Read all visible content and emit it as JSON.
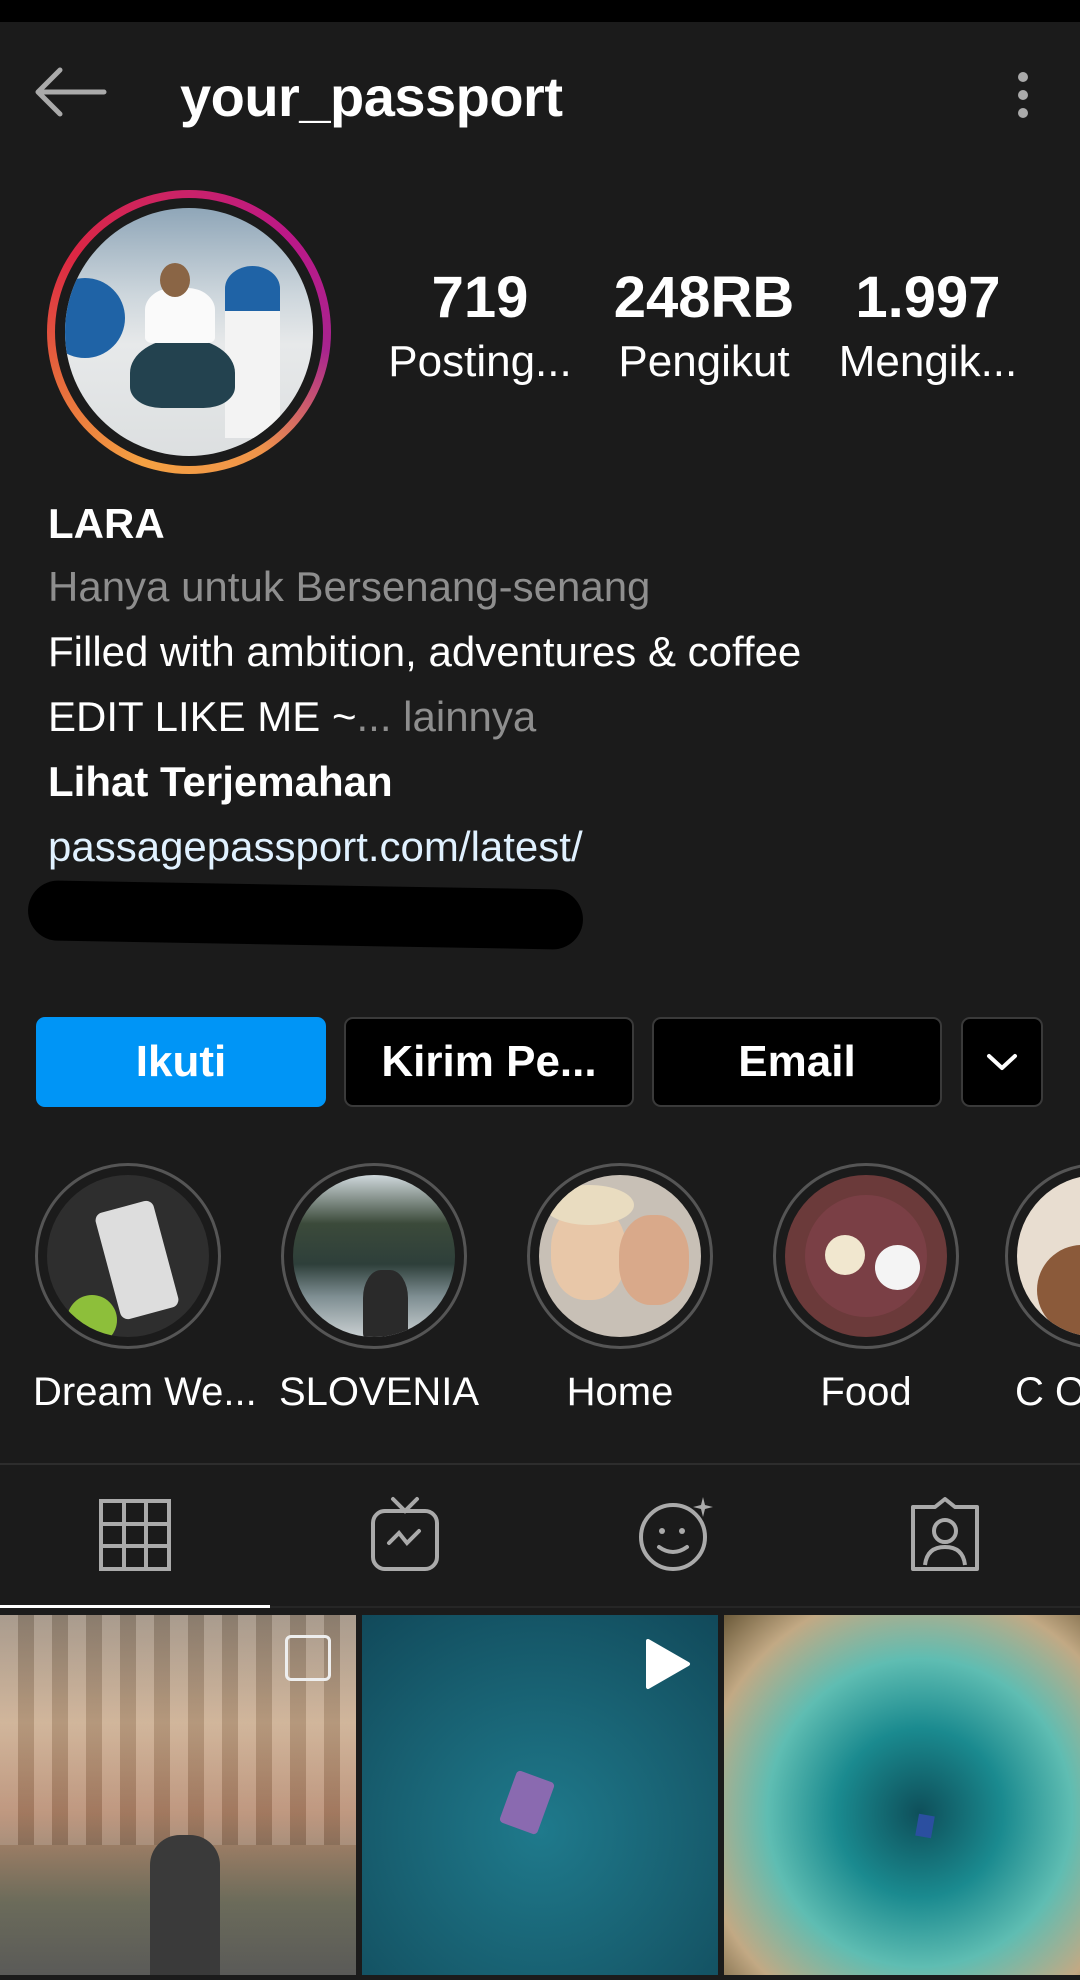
{
  "header": {
    "username": "your_passport",
    "back_icon": "arrow-left-icon",
    "more_icon": "vertical-dots-icon"
  },
  "stats": [
    {
      "value": "719",
      "label": "Posting..."
    },
    {
      "value": "248RB",
      "label": "Pengikut"
    },
    {
      "value": "1.997",
      "label": "Mengik..."
    }
  ],
  "bio": {
    "name": "LARA",
    "category": "Hanya untuk Bersenang-senang",
    "line1": "Filled with ambition, adventures & coffee",
    "line2": "EDIT LIKE ME ~",
    "more": "... lainnya",
    "translate": "Lihat Terjemahan",
    "link": "passagepassport.com/latest/"
  },
  "buttons": {
    "follow": "Ikuti",
    "message": "Kirim Pe...",
    "email": "Email",
    "dropdown_icon": "chevron-down-icon"
  },
  "highlights": [
    {
      "label": "Dream We..."
    },
    {
      "label": "SLOVENIA"
    },
    {
      "label": "Home"
    },
    {
      "label": "Food"
    },
    {
      "label": "C O"
    }
  ],
  "tabs": [
    {
      "icon": "grid-icon",
      "active": true
    },
    {
      "icon": "igtv-icon",
      "active": false
    },
    {
      "icon": "effects-icon",
      "active": false
    },
    {
      "icon": "tagged-icon",
      "active": false
    }
  ],
  "colors": {
    "background": "#1b1b1b",
    "accent": "#0095f6",
    "muted": "#8e8e8e",
    "link": "#e0f1ff"
  }
}
